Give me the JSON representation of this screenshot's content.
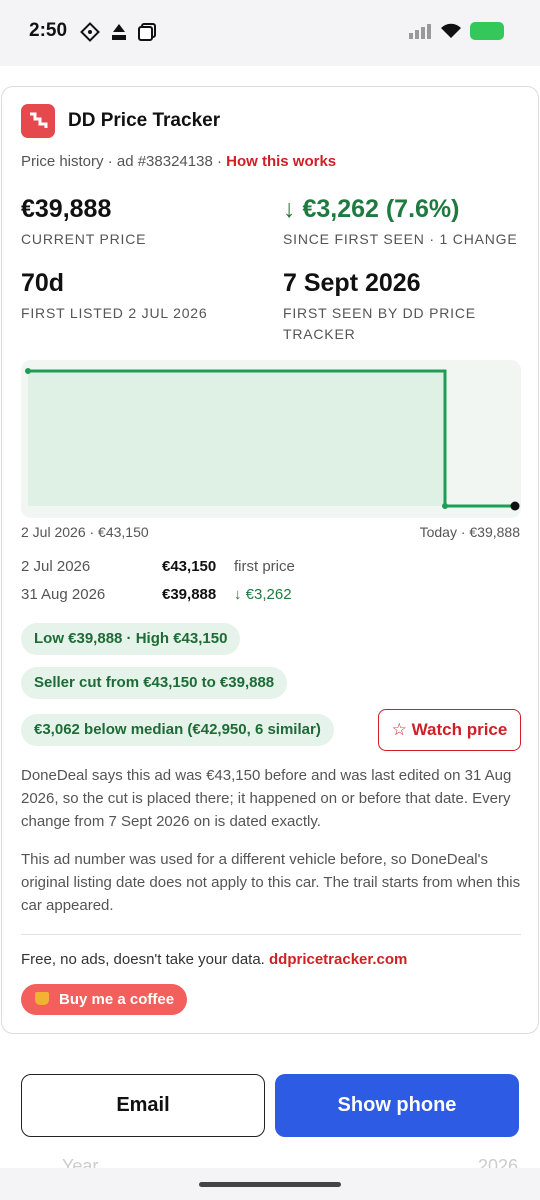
{
  "status_bar": {
    "time": "2:50"
  },
  "header": {
    "title": "DD Price Tracker"
  },
  "subline": {
    "prefix": "Price history · ad #38324138 · ",
    "link": "How this works"
  },
  "stats": {
    "current_price": {
      "value": "€39,888",
      "label": "CURRENT PRICE"
    },
    "change": {
      "value": "↓ €3,262 (7.6%)",
      "label": "SINCE FIRST SEEN · 1 CHANGE"
    },
    "age": {
      "value": "70d",
      "label": "FIRST LISTED 2 JUL 2026"
    },
    "first_seen": {
      "value": "7 Sept 2026",
      "label": "FIRST SEEN BY DD PRICE TRACKER"
    }
  },
  "chart_data": {
    "type": "area",
    "x": [
      "2 Jul 2026",
      "31 Aug 2026",
      "Today"
    ],
    "values": [
      43150,
      39888,
      39888
    ],
    "start_label": "2 Jul 2026 · €43,150",
    "end_label": "Today · €39,888",
    "color": "#1e9e55"
  },
  "history": [
    {
      "date": "2 Jul 2026",
      "price": "€43,150",
      "note": "first price"
    },
    {
      "date": "31 Aug 2026",
      "price": "€39,888",
      "note": "↓ €3,262"
    }
  ],
  "pills": {
    "range": "Low €39,888 · High €43,150",
    "seller_cut": "Seller cut from €43,150 to €39,888",
    "median": "€3,062 below median (€42,950, 6 similar)"
  },
  "watch_button": "☆ Watch price",
  "paragraphs": {
    "p1": "DoneDeal says this ad was €43,150 before and was last edited on 31 Aug 2026, so the cut is placed there; it happened on or before that date. Every change from 7 Sept 2026 on is dated exactly.",
    "p2": "This ad number was used for a different vehicle before, so DoneDeal's original listing date does not apply to this car. The trail starts from when this car appeared."
  },
  "footer": {
    "text": "Free, no ads, doesn't take your data.",
    "link": "ddpricetracker.com",
    "coffee": "Buy me a coffee"
  },
  "actions": {
    "email": "Email",
    "phone": "Show phone"
  },
  "peek": {
    "left": "Year",
    "right": "2026"
  },
  "colors": {
    "accent_red": "#d01f25",
    "green": "#1e7a3e",
    "blue": "#2d5be3"
  }
}
